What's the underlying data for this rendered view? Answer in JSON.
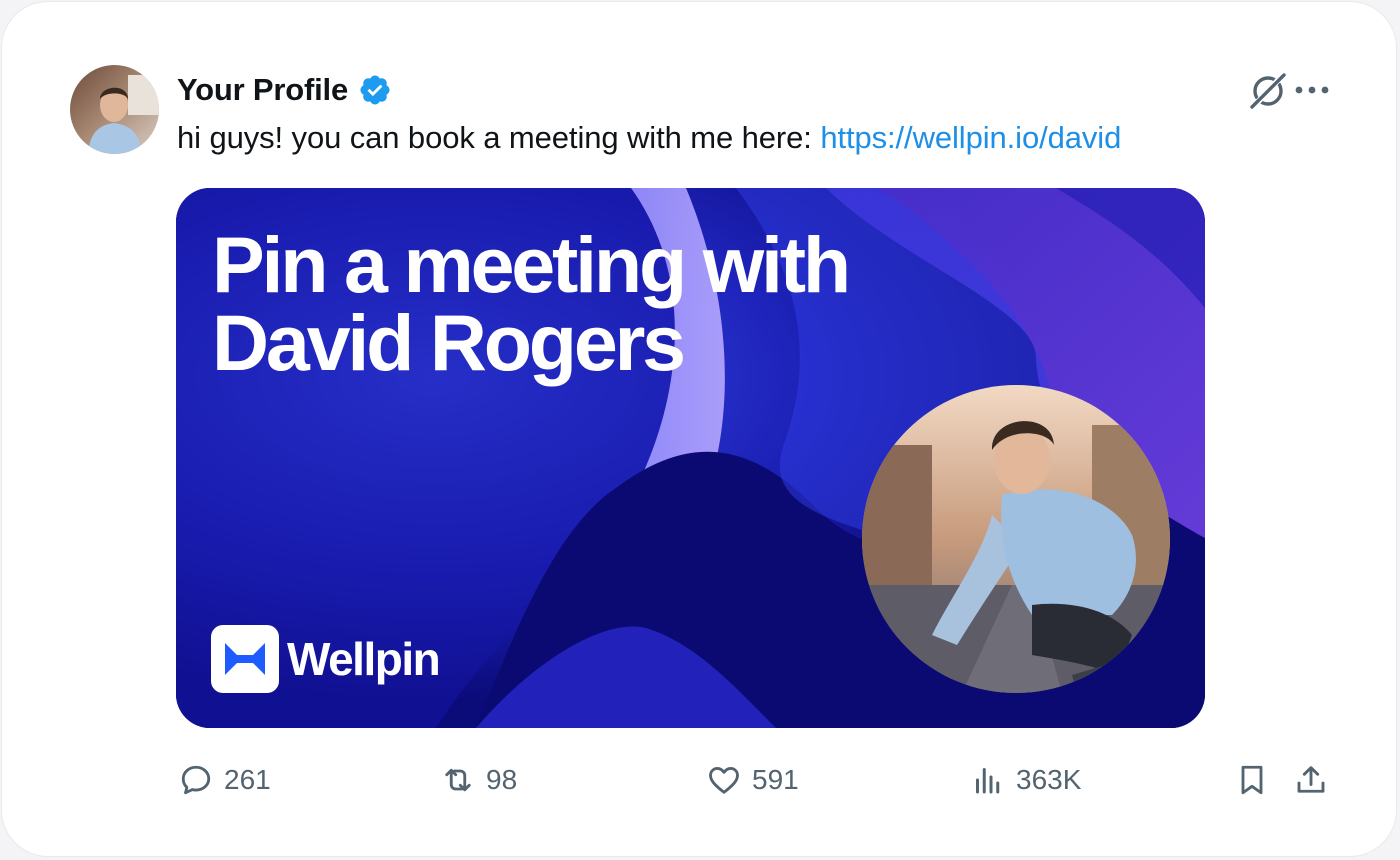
{
  "post": {
    "author": "Your Profile",
    "text": "hi guys! you can book a meeting with me here:",
    "link": "https://wellpin.io/david"
  },
  "media": {
    "headline_line1": "Pin a meeting with",
    "headline_line2": "David Rogers",
    "brand": "Wellpin"
  },
  "actions": {
    "replies": "261",
    "reposts": "98",
    "likes": "591",
    "views": "363K"
  },
  "colors": {
    "link": "#1d8fe6",
    "verified": "#1d9bf0",
    "icon": "#536471",
    "brand_blue": "#1f5cff"
  },
  "icons": [
    "verified-badge-icon",
    "grok-icon",
    "more-icon",
    "reply-icon",
    "repost-icon",
    "like-icon",
    "views-icon",
    "bookmark-icon",
    "share-icon"
  ]
}
